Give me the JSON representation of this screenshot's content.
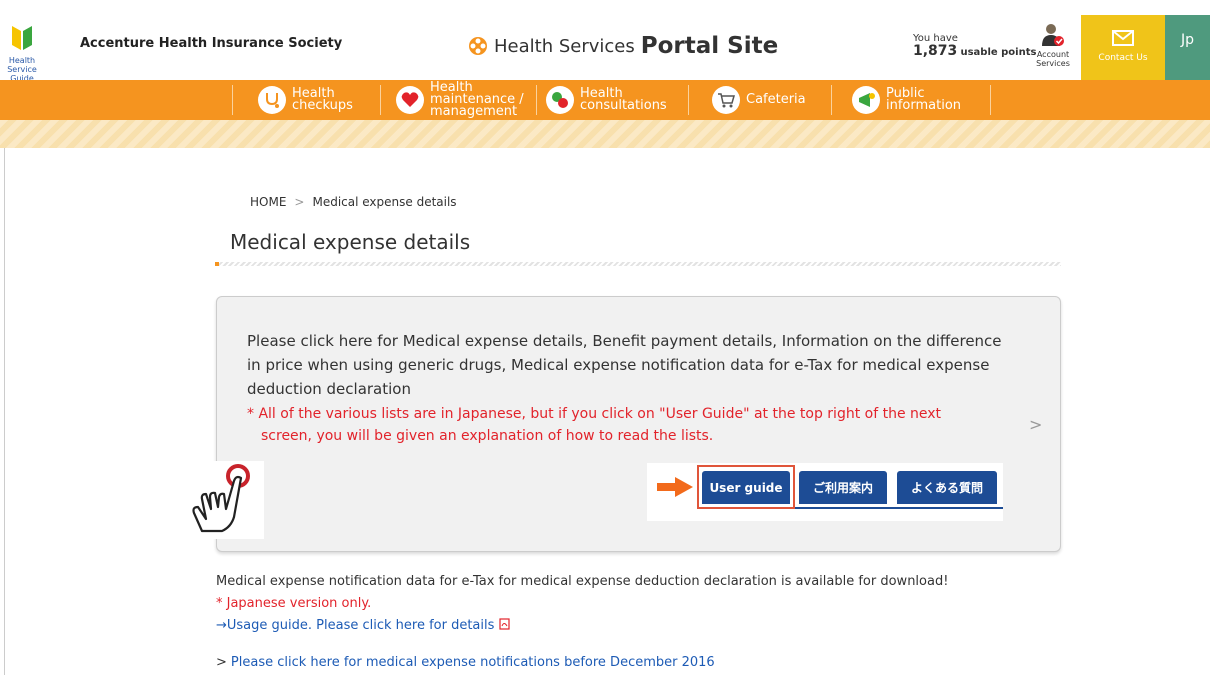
{
  "header": {
    "guide_label": "Health Service Guide",
    "org_name": "Accenture Health Insurance Society",
    "portal_prefix": "Health Services",
    "portal_big": "Portal Site",
    "points_prefix": "You have",
    "points_value": "1,873",
    "points_suffix": "usable points",
    "account_label": "Account Services",
    "contact_label": "Contact Us",
    "lang_label": "Jp"
  },
  "nav": {
    "items": [
      {
        "line1": "Health",
        "line2": "checkups"
      },
      {
        "line1": "Health",
        "line2": "maintenance /",
        "line3": "management"
      },
      {
        "line1": "Health",
        "line2": "consultations"
      },
      {
        "line1": "Cafeteria"
      },
      {
        "line1": "Public",
        "line2": "information"
      }
    ]
  },
  "breadcrumb": {
    "home": "HOME",
    "sep": ">",
    "current": "Medical expense details"
  },
  "page_title": "Medical expense details",
  "card": {
    "text": "Please click here for Medical expense details, Benefit payment details,   Information on the difference in price when using generic drugs, Medical expense notification data for e-Tax for medical expense deduction declaration",
    "note_line1": "* All of the various lists are in Japanese, but if you click on \"User Guide\" at the top right of the next",
    "note_line2": "screen, you will be given an explanation of how to read the lists.",
    "chevron": ">",
    "buttons": [
      "User guide",
      "ご利用案内",
      "よくある質問"
    ]
  },
  "info": {
    "line1": "Medical expense notification data for e-Tax for medical expense deduction declaration is available for download!",
    "line2": "* Japanese version only.",
    "line3": "→Usage guide. Please click here for details",
    "line4_marker": ">",
    "line4": "Please click here for medical expense notifications before December 2016"
  },
  "colors": {
    "nav_orange": "#f5941f",
    "button_blue": "#1d4c95",
    "note_red": "#e2232b",
    "link_blue": "#1d5bb5",
    "contact_yellow": "#f0c419",
    "lang_green": "#4f9a7e"
  }
}
